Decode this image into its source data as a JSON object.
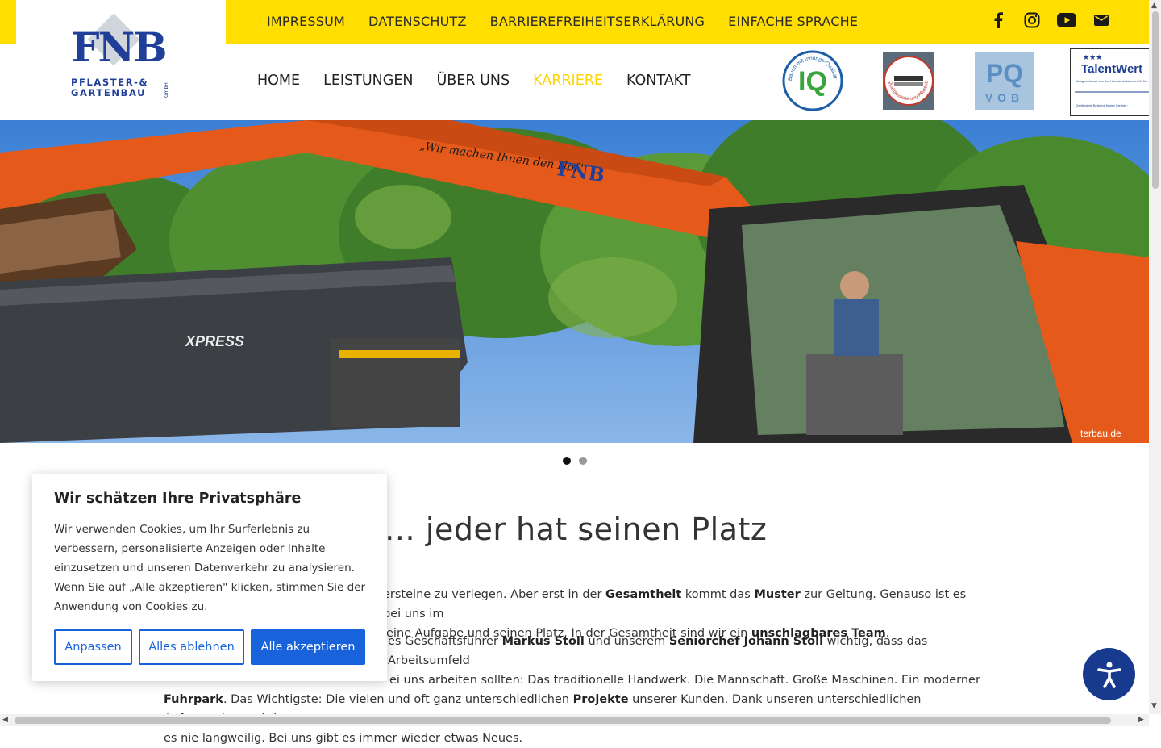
{
  "brand": {
    "logo_text": "FNB",
    "logo_sub1": "PFLASTER-&",
    "logo_sub2": "GARTENBAU",
    "logo_legal": "GmbH",
    "blue": "#1f3f98",
    "yellow": "#ffde00"
  },
  "topnav": [
    "IMPRESSUM",
    "DATENSCHUTZ",
    "BARRIEREFREIHEITSERKLÄRUNG",
    "EINFACHE SPRACHE"
  ],
  "social_icons": [
    "facebook-icon",
    "instagram-icon",
    "youtube-icon",
    "mail-icon"
  ],
  "mainnav": {
    "items": [
      "HOME",
      "LEISTUNGEN",
      "ÜBER UNS",
      "KARRIERE",
      "KONTAKT"
    ],
    "active": "KARRIERE",
    "active_color": "#ffd400"
  },
  "badges": {
    "iq": {
      "text": "IQ",
      "ring_text": "Bauen mit Innungs-Qualität e.V."
    },
    "quality_seal": {
      "ring_text": "Qualitätssicherung Pflasterbaubetriebe"
    },
    "pq": {
      "line1": "PQ",
      "line2": "VOB"
    },
    "talentwert": {
      "stars": "★★★",
      "title": "TalentWert",
      "sub": "Ausgezeichnet von der Handwerkskammer für M...",
      "foot": "Zertifizierte Betriebe finden Sie hier:"
    }
  },
  "hero": {
    "excavator_slogan": "„Wir machen Ihnen den Hof\"",
    "excavator_brand": "FNB",
    "truck_brand": "XPRESS",
    "site_text": "terbau.de",
    "slide_count": 2,
    "active_slide": 1
  },
  "content": {
    "headline_visible": "erlegemuster … jeder hat seinen Platz",
    "para1_line1_start": "ersteine zu verlegen. Aber erst in der ",
    "para1_b1": "Gesamtheit",
    "para1_m1": " kommt das ",
    "para1_b2": "Muster",
    "para1_e1": " zur Geltung. Genauso ist es bei uns im",
    "para1_line2_start": "eine Aufgabe und seinen Platz. In der Gesamtheit sind wir ein ",
    "para1_b3": "unschlagbares Team",
    "para1_end": ".",
    "para2_line1_start": "es Geschäftsführer ",
    "para2_b1": "Markus Stoll",
    "para2_m1": " und unserem ",
    "para2_b2": "Seniorchef Johann Stoll",
    "para2_e1": " wichtig, dass das Arbeitsumfeld",
    "para2_line2": "ei uns arbeiten sollten: Das traditionelle Handwerk. Die Mannschaft. Große Maschinen. Ein moderner",
    "para2_line3_b": "Fuhrpark",
    "para2_line3_m": ". Das Wichtigste: Die vielen und oft ganz unterschiedlichen ",
    "para2_line3_b2": "Projekte",
    "para2_line3_e": " unserer Kunden. Dank unseren unterschiedlichen Auftraggebern wird",
    "para2_line4": "es nie langweilig. Bei uns gibt es immer wieder etwas Neues."
  },
  "cookie": {
    "title": "Wir schätzen Ihre Privatsphäre",
    "text": "Wir verwenden Cookies, um Ihr Surferlebnis zu verbessern, personalisierte Anzeigen oder Inhalte einzusetzen und unseren Datenverkehr zu analysieren. Wenn Sie auf „Alle akzeptieren\" klicken, stimmen Sie der Anwendung von Cookies zu.",
    "btn_customize": "Anpassen",
    "btn_reject": "Alles ablehnen",
    "btn_accept": "Alle akzeptieren",
    "accent": "#1863dc"
  },
  "accessibility_button": {
    "icon": "accessibility-icon",
    "color": "#173a8f"
  }
}
